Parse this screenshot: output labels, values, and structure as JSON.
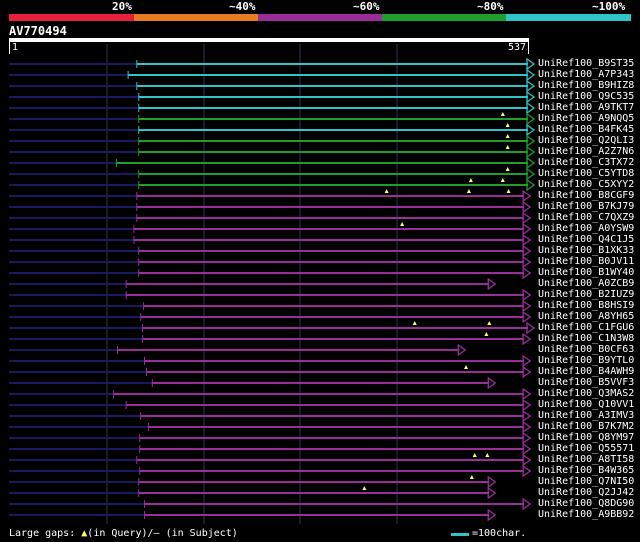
{
  "identity_legend": {
    "labels": [
      "20%",
      "~40%",
      "~60%",
      "~80%",
      "~100%"
    ],
    "colors": [
      "#e8213b",
      "#e87a22",
      "#992e99",
      "#1e9e2b",
      "#2ec4c9"
    ]
  },
  "query": {
    "id": "AV770494",
    "start_label": "1",
    "end_label": "537",
    "length": 537
  },
  "hits": [
    {
      "name": "UniRef100_B9ST35",
      "start": 133,
      "end": 537,
      "class": 4,
      "gaps": [],
      "arrow": true
    },
    {
      "name": "UniRef100_A7P343",
      "start": 124,
      "end": 537,
      "class": 4,
      "gaps": [],
      "arrow": true
    },
    {
      "name": "UniRef100_B9HIZ8",
      "start": 133,
      "end": 537,
      "class": 4,
      "gaps": [],
      "arrow": true
    },
    {
      "name": "UniRef100_Q9C535",
      "start": 135,
      "end": 537,
      "class": 4,
      "gaps": [],
      "arrow": true
    },
    {
      "name": "UniRef100_A9TKT7",
      "start": 135,
      "end": 537,
      "class": 4,
      "gaps": [],
      "arrow": true
    },
    {
      "name": "UniRef100_A9NQQ5",
      "start": 135,
      "end": 537,
      "class": 3,
      "gaps": [
        511
      ],
      "arrow": true
    },
    {
      "name": "UniRef100_B4FK45",
      "start": 135,
      "end": 537,
      "class": 4,
      "gaps": [
        516
      ],
      "arrow": true
    },
    {
      "name": "UniRef100_Q2QLI3",
      "start": 135,
      "end": 537,
      "class": 3,
      "gaps": [
        516
      ],
      "arrow": true
    },
    {
      "name": "UniRef100_A2Z7N6",
      "start": 135,
      "end": 537,
      "class": 3,
      "gaps": [
        516
      ],
      "arrow": true
    },
    {
      "name": "UniRef100_C3TX72",
      "start": 112,
      "end": 537,
      "class": 3,
      "gaps": [],
      "arrow": true
    },
    {
      "name": "UniRef100_C5YTD8",
      "start": 135,
      "end": 537,
      "class": 3,
      "gaps": [
        516
      ],
      "arrow": true
    },
    {
      "name": "UniRef100_C5XYY2",
      "start": 135,
      "end": 537,
      "class": 3,
      "gaps": [
        478,
        511
      ],
      "arrow": true
    },
    {
      "name": "UniRef100_B8CGF9",
      "start": 133,
      "end": 533,
      "class": 2,
      "gaps": [
        391,
        476,
        517
      ],
      "arrow": true
    },
    {
      "name": "UniRef100_B7KJ79",
      "start": 133,
      "end": 533,
      "class": 2,
      "gaps": [],
      "arrow": true
    },
    {
      "name": "UniRef100_C7QXZ9",
      "start": 133,
      "end": 533,
      "class": 2,
      "gaps": [],
      "arrow": true
    },
    {
      "name": "UniRef100_A0YSW9",
      "start": 130,
      "end": 533,
      "class": 2,
      "gaps": [
        407
      ],
      "arrow": true
    },
    {
      "name": "UniRef100_Q4C1J5",
      "start": 130,
      "end": 533,
      "class": 2,
      "gaps": [],
      "arrow": true
    },
    {
      "name": "UniRef100_B1XK33",
      "start": 135,
      "end": 533,
      "class": 2,
      "gaps": [],
      "arrow": true
    },
    {
      "name": "UniRef100_B0JV11",
      "start": 135,
      "end": 533,
      "class": 2,
      "gaps": [],
      "arrow": true
    },
    {
      "name": "UniRef100_B1WY40",
      "start": 135,
      "end": 533,
      "class": 2,
      "gaps": [],
      "arrow": true
    },
    {
      "name": "UniRef100_A0ZCB9",
      "start": 122,
      "end": 497,
      "class": 2,
      "gaps": [],
      "arrow": true
    },
    {
      "name": "UniRef100_B2IUZ9",
      "start": 122,
      "end": 533,
      "class": 2,
      "gaps": [],
      "arrow": true
    },
    {
      "name": "UniRef100_B8HSI9",
      "start": 140,
      "end": 533,
      "class": 2,
      "gaps": [],
      "arrow": true
    },
    {
      "name": "UniRef100_A8YH65",
      "start": 137,
      "end": 533,
      "class": 2,
      "gaps": [],
      "arrow": true
    },
    {
      "name": "UniRef100_C1FGU6",
      "start": 139,
      "end": 537,
      "class": 2,
      "gaps": [
        420,
        497
      ],
      "arrow": true
    },
    {
      "name": "UniRef100_C1N3W8",
      "start": 139,
      "end": 533,
      "class": 2,
      "gaps": [
        494
      ],
      "arrow": true
    },
    {
      "name": "UniRef100_B0CF63",
      "start": 113,
      "end": 466,
      "class": 2,
      "gaps": [],
      "arrow": true
    },
    {
      "name": "UniRef100_B9YTL0",
      "start": 141,
      "end": 533,
      "class": 2,
      "gaps": [],
      "arrow": true
    },
    {
      "name": "UniRef100_B4AWH9",
      "start": 143,
      "end": 533,
      "class": 2,
      "gaps": [
        473
      ],
      "arrow": true
    },
    {
      "name": "UniRef100_B5VVF3",
      "start": 149,
      "end": 497,
      "class": 2,
      "gaps": [],
      "arrow": true
    },
    {
      "name": "UniRef100_Q3MAS2",
      "start": 109,
      "end": 533,
      "class": 2,
      "gaps": [],
      "arrow": true
    },
    {
      "name": "UniRef100_Q10VV1",
      "start": 122,
      "end": 533,
      "class": 2,
      "gaps": [],
      "arrow": true
    },
    {
      "name": "UniRef100_A3IMV3",
      "start": 137,
      "end": 533,
      "class": 2,
      "gaps": [],
      "arrow": true
    },
    {
      "name": "UniRef100_B7K7M2",
      "start": 145,
      "end": 533,
      "class": 2,
      "gaps": [],
      "arrow": true
    },
    {
      "name": "UniRef100_Q8YM97",
      "start": 136,
      "end": 533,
      "class": 2,
      "gaps": [],
      "arrow": true
    },
    {
      "name": "UniRef100_Q55571",
      "start": 136,
      "end": 533,
      "class": 2,
      "gaps": [],
      "arrow": true
    },
    {
      "name": "UniRef100_A8TI58",
      "start": 133,
      "end": 533,
      "class": 2,
      "gaps": [
        482,
        495
      ],
      "arrow": true
    },
    {
      "name": "UniRef100_B4W365",
      "start": 136,
      "end": 533,
      "class": 2,
      "gaps": [],
      "arrow": true
    },
    {
      "name": "UniRef100_Q7NI50",
      "start": 135,
      "end": 497,
      "class": 2,
      "gaps": [
        479
      ],
      "arrow": true
    },
    {
      "name": "UniRef100_Q2JJ42",
      "start": 135,
      "end": 497,
      "class": 2,
      "gaps": [
        368
      ],
      "arrow": true
    },
    {
      "name": "UniRef100_Q8DG90",
      "start": 141,
      "end": 533,
      "class": 2,
      "gaps": [],
      "arrow": true
    },
    {
      "name": "UniRef100_A9BB92",
      "start": 141,
      "end": 497,
      "class": 2,
      "gaps": [],
      "arrow": true
    }
  ],
  "legend": {
    "prefix": "Large gaps:",
    "query_symbol": "▲",
    "query_text": "(in Query)/",
    "subject_symbol": "—",
    "subject_text": " (in Subject)",
    "scale_text": "=100char."
  }
}
